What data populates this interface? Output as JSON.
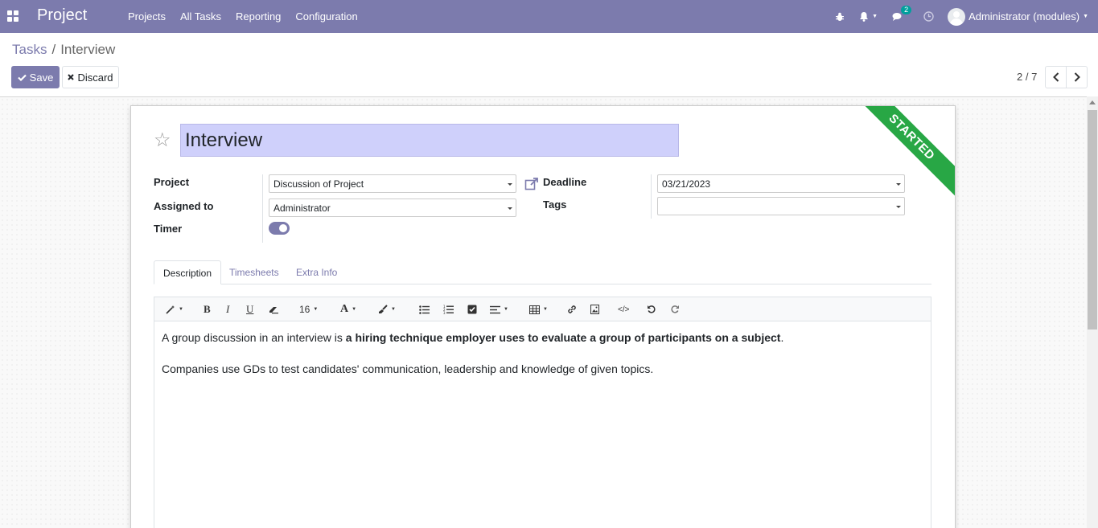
{
  "navbar": {
    "brand": "Project",
    "menu": [
      "Projects",
      "All Tasks",
      "Reporting",
      "Configuration"
    ],
    "chat_count": "2",
    "user": "Administrator (modules)"
  },
  "breadcrumb": {
    "parent": "Tasks",
    "separator": "/",
    "current": "Interview"
  },
  "buttons": {
    "save": "Save",
    "discard": "Discard"
  },
  "pager": {
    "value": "2 / 7"
  },
  "status_ribbon": "STARTED",
  "task": {
    "name": "Interview",
    "project_label": "Project",
    "project_value": "Discussion of Project",
    "assigned_label": "Assigned to",
    "assigned_value": "Administrator",
    "timer_label": "Timer",
    "timer_on": true,
    "deadline_label": "Deadline",
    "deadline_value": "03/21/2023",
    "tags_label": "Tags",
    "tags_value": ""
  },
  "tabs": [
    "Description",
    "Timesheets",
    "Extra Info"
  ],
  "editor": {
    "font_size": "16",
    "p1_start": "A group discussion in an interview is ",
    "p1_bold": "a hiring technique employer uses to evaluate a group of participants on a subject",
    "p1_end": ".",
    "p2": "Companies use GDs to test candidates' communication, leadership and knowledge of given topics."
  },
  "colors": {
    "navbar": "#7c7bad",
    "ribbon": "#28a745",
    "name_bg": "#cfd0fb"
  }
}
